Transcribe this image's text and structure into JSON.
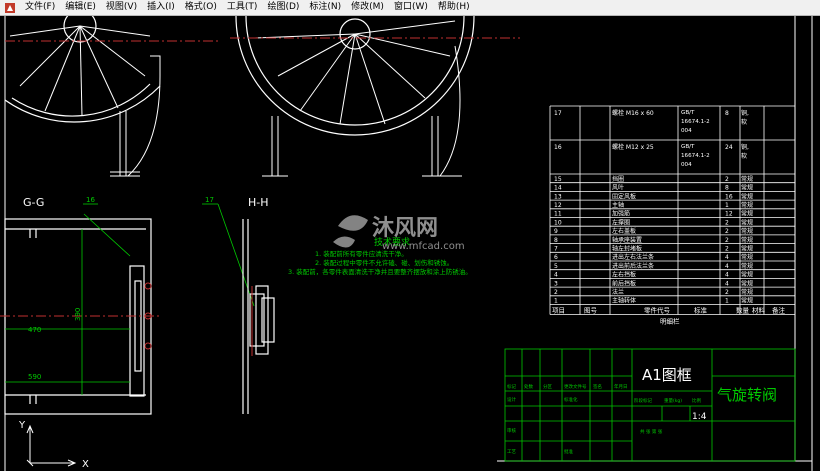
{
  "menu": {
    "items": [
      {
        "label": "文件(F)"
      },
      {
        "label": "编辑(E)"
      },
      {
        "label": "视图(V)"
      },
      {
        "label": "插入(I)"
      },
      {
        "label": "格式(O)"
      },
      {
        "label": "工具(T)"
      },
      {
        "label": "绘图(D)"
      },
      {
        "label": "标注(N)"
      },
      {
        "label": "修改(M)"
      },
      {
        "label": "窗口(W)"
      },
      {
        "label": "帮助(H)"
      }
    ]
  },
  "drawing": {
    "view_gg_label": "G-G",
    "view_hh_label": "H-H",
    "balloon_16": "16",
    "balloon_17": "17",
    "dim_470": "470",
    "dim_590": "590",
    "dim_390": "390",
    "tech_requirements": {
      "title": "技术要求",
      "lines": [
        "1. 装配前所有零件应清洗干净。",
        "2. 装配过程中零件不允许磕、碰、划伤和锈蚀。",
        "3. 装配前，各零件表面清洗干净并且要整齐摆放和涂上防锈油。"
      ]
    },
    "watermark": {
      "brand": "沐风网",
      "url": "www.mfcad.com"
    },
    "axis_x": "X",
    "axis_y": "Y"
  },
  "bom": {
    "rows": [
      {
        "no": "17",
        "name": "螺栓 M16 x 60",
        "std": "GB/T 16674.1-2 004",
        "qty": "8",
        "mat": "铜, 软"
      },
      {
        "no": "16",
        "name": "螺栓 M12 x 25",
        "std": "GB/T 16674.1-2 004",
        "qty": "24",
        "mat": "铜, 软"
      },
      {
        "no": "15",
        "name": "挡圈",
        "std": "",
        "qty": "2",
        "mat": "常规"
      },
      {
        "no": "14",
        "name": "风叶",
        "std": "",
        "qty": "8",
        "mat": "常规"
      },
      {
        "no": "13",
        "name": "固定风板",
        "std": "",
        "qty": "16",
        "mat": "常规"
      },
      {
        "no": "12",
        "name": "主轴",
        "std": "",
        "qty": "1",
        "mat": "常规"
      },
      {
        "no": "11",
        "name": "加强筋",
        "std": "",
        "qty": "12",
        "mat": "常规"
      },
      {
        "no": "10",
        "name": "左撑圈",
        "std": "",
        "qty": "2",
        "mat": "常规"
      },
      {
        "no": "9",
        "name": "左右盖板",
        "std": "",
        "qty": "2",
        "mat": "常规"
      },
      {
        "no": "8",
        "name": "轴承座装置",
        "std": "",
        "qty": "2",
        "mat": "常规"
      },
      {
        "no": "7",
        "name": "轴左封堵板",
        "std": "",
        "qty": "2",
        "mat": "常规"
      },
      {
        "no": "6",
        "name": "进出左右法兰条",
        "std": "",
        "qty": "4",
        "mat": "常规"
      },
      {
        "no": "5",
        "name": "进出前后法兰条",
        "std": "",
        "qty": "4",
        "mat": "常规"
      },
      {
        "no": "4",
        "name": "左右挡板",
        "std": "",
        "qty": "4",
        "mat": "常规"
      },
      {
        "no": "3",
        "name": "前后挡板",
        "std": "",
        "qty": "4",
        "mat": "常规"
      },
      {
        "no": "2",
        "name": "法兰",
        "std": "",
        "qty": "2",
        "mat": "常规"
      },
      {
        "no": "1",
        "name": "主轴转体",
        "std": "",
        "qty": "1",
        "mat": "常规"
      }
    ],
    "header": {
      "no": "项目",
      "code": "图号",
      "name": "零件代号",
      "std": "标准",
      "qty": "数量",
      "mat": "材料",
      "remark": "备注"
    },
    "footer": "明细栏"
  },
  "title_block": {
    "frame_label": "A1图框",
    "drawing_name": "气旋转阀",
    "scale": "1:4",
    "cells": {
      "marker": "标记",
      "count": "处数",
      "zone": "分区",
      "change_doc": "更改文件号",
      "sign": "签名",
      "date": "年月日",
      "designer": "设计",
      "standardize": "标准化",
      "stage": "阶段标记",
      "weight": "重量(kg)",
      "ratio": "比例",
      "review": "审核",
      "process": "工艺",
      "approve": "批准",
      "sheet": "共 张 第 张"
    }
  }
}
